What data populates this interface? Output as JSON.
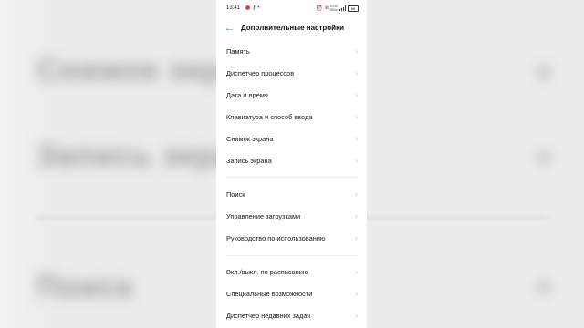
{
  "status_bar": {
    "time": "13:41",
    "network_speed": "0,00\nКБ/с",
    "battery": "88"
  },
  "header": {
    "title": "Дополнительные настройки"
  },
  "items": [
    {
      "label": "Память"
    },
    {
      "label": "Диспетчер процессов"
    },
    {
      "label": "Дата и время"
    },
    {
      "label": "Клавиатура и способ ввода"
    },
    {
      "label": "Снимок экрана"
    },
    {
      "label": "Запись экрана"
    },
    {
      "label": "Поиск"
    },
    {
      "label": "Управление загрузками"
    },
    {
      "label": "Руководство по использованию"
    },
    {
      "label": "Вкл./выкл. по расписанию"
    },
    {
      "label": "Специальные возможности"
    },
    {
      "label": "Диспетчер недавних задач"
    }
  ],
  "icons": {
    "back": "back-arrow-icon",
    "chevron": "chevron-right-icon"
  },
  "colors": {
    "accent": "#3a7bd5",
    "screen_bg": "#ffffff",
    "backdrop": "#ececec"
  }
}
